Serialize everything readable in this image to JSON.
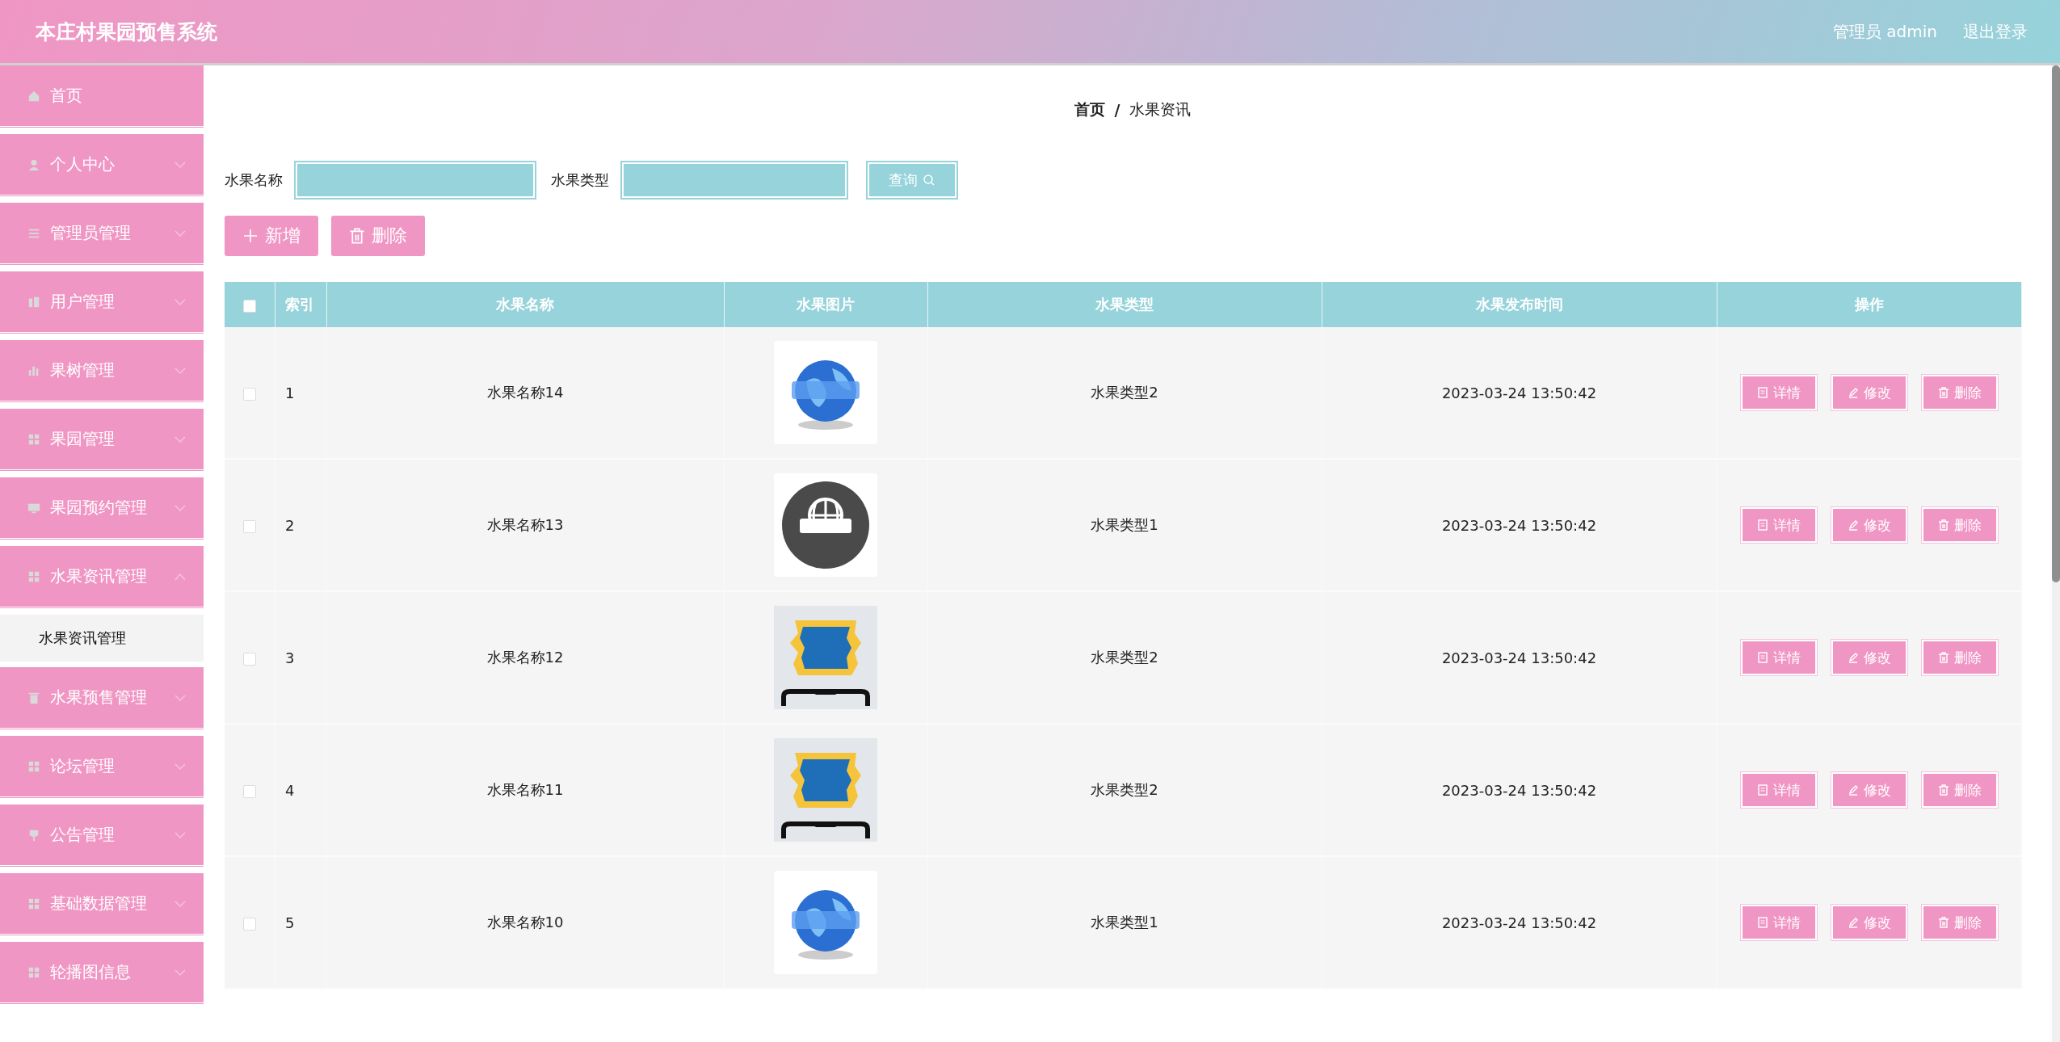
{
  "header": {
    "title": "本庄村果园预售系统",
    "user": "管理员 admin",
    "logout": "退出登录"
  },
  "sidebar": {
    "items": [
      {
        "label": "首页"
      },
      {
        "label": "个人中心",
        "expanded": false
      },
      {
        "label": "管理员管理",
        "expanded": false
      },
      {
        "label": "用户管理",
        "expanded": false
      },
      {
        "label": "果树管理",
        "expanded": false
      },
      {
        "label": "果园管理",
        "expanded": false
      },
      {
        "label": "果园预约管理",
        "expanded": false
      },
      {
        "label": "水果资讯管理",
        "expanded": true,
        "children": [
          {
            "label": "水果资讯管理",
            "selected": true
          }
        ]
      },
      {
        "label": "水果预售管理",
        "expanded": false
      },
      {
        "label": "论坛管理",
        "expanded": false
      },
      {
        "label": "公告管理",
        "expanded": false
      },
      {
        "label": "基础数据管理",
        "expanded": false
      },
      {
        "label": "轮播图信息",
        "expanded": false
      }
    ]
  },
  "breadcrumb": {
    "items": [
      "首页",
      "水果资讯"
    ],
    "separator": "/"
  },
  "search": {
    "fields": [
      {
        "label": "水果名称"
      },
      {
        "label": "水果类型"
      }
    ],
    "button": "查询"
  },
  "actions": {
    "add": "新增",
    "delete": "删除"
  },
  "table": {
    "header_checked": false,
    "columns": [
      "索引",
      "水果名称",
      "水果图片",
      "水果类型",
      "水果发布时间",
      "操作"
    ],
    "rows": [
      {
        "checked": false,
        "index": "1",
        "name": "水果名称14",
        "image": {
          "kind": "globe"
        },
        "type": "水果类型2",
        "time": "2023-03-24 13:50:42",
        "actions": [
          "详情",
          "修改",
          "删除"
        ]
      },
      {
        "checked": false,
        "index": "2",
        "name": "水果名称13",
        "image": {
          "kind": "badge"
        },
        "type": "水果类型1",
        "time": "2023-03-24 13:50:42",
        "actions": [
          "详情",
          "修改",
          "删除"
        ]
      },
      {
        "checked": false,
        "index": "3",
        "name": "水果名称12",
        "image": {
          "kind": "phone"
        },
        "type": "水果类型2",
        "time": "2023-03-24 13:50:42",
        "actions": [
          "详情",
          "修改",
          "删除"
        ]
      },
      {
        "checked": false,
        "index": "4",
        "name": "水果名称11",
        "image": {
          "kind": "phone"
        },
        "type": "水果类型2",
        "time": "2023-03-24 13:50:42",
        "actions": [
          "详情",
          "修改",
          "删除"
        ]
      },
      {
        "checked": false,
        "index": "5",
        "name": "水果名称10",
        "image": {
          "kind": "globe"
        },
        "type": "水果类型1",
        "time": "2023-03-24 13:50:42",
        "actions": [
          "详情",
          "修改",
          "删除"
        ]
      }
    ]
  }
}
